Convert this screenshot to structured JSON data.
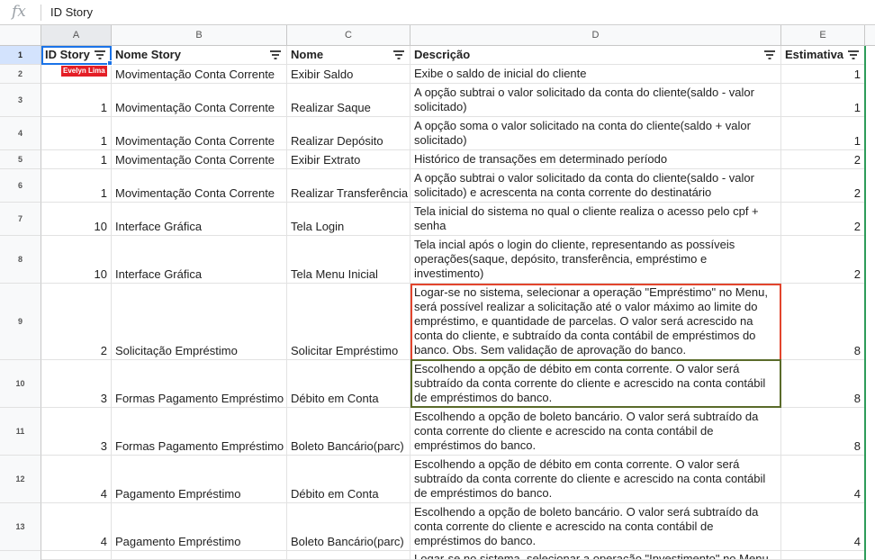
{
  "formula_bar": {
    "icon": "fx-icon",
    "value": "ID Story"
  },
  "columns": [
    {
      "letter": "A",
      "header": "ID Story"
    },
    {
      "letter": "B",
      "header": "Nome Story"
    },
    {
      "letter": "C",
      "header": "Nome"
    },
    {
      "letter": "D",
      "header": "Descrição"
    },
    {
      "letter": "E",
      "header": "Estimativa"
    }
  ],
  "active_cell": "A1",
  "collaborator_tag": "Evelyn Lima",
  "row_numbers": [
    "1",
    "2",
    "3",
    "4",
    "5",
    "6",
    "7",
    "8",
    "9",
    "10",
    "11",
    "12",
    "13"
  ],
  "rows": [
    {
      "id": "",
      "story": "Movimentação Conta Corrente",
      "nome": "Exibir Saldo",
      "descricao": "Exibe o saldo de inicial do cliente",
      "estimativa": "1"
    },
    {
      "id": "1",
      "story": "Movimentação Conta Corrente",
      "nome": "Realizar Saque",
      "descricao": "A opção subtrai o valor solicitado da conta do cliente(saldo - valor solicitado)",
      "estimativa": "1"
    },
    {
      "id": "1",
      "story": "Movimentação Conta Corrente",
      "nome": "Realizar Depósito",
      "descricao": "A opção soma o valor solicitado na conta do cliente(saldo + valor solicitado)",
      "estimativa": "1"
    },
    {
      "id": "1",
      "story": "Movimentação Conta Corrente",
      "nome": "Exibir Extrato",
      "descricao": "Histórico de transações em determinado período",
      "estimativa": "2"
    },
    {
      "id": "1",
      "story": "Movimentação Conta Corrente",
      "nome": "Realizar Transferência",
      "descricao": "A opção subtrai o valor solicitado da conta do cliente(saldo - valor solicitado) e acrescenta na conta corrente do destinatário",
      "estimativa": "2"
    },
    {
      "id": "10",
      "story": "Interface Gráfica",
      "nome": "Tela Login",
      "descricao": "Tela inicial do sistema no qual o cliente realiza o acesso pelo cpf + senha",
      "estimativa": "2"
    },
    {
      "id": "10",
      "story": "Interface Gráfica",
      "nome": "Tela Menu Inicial",
      "descricao": "Tela incial após o login do cliente, representando as possíveis operações(saque, depósito, transferência, empréstimo e investimento)",
      "estimativa": "2"
    },
    {
      "id": "2",
      "story": "Solicitação Empréstimo",
      "nome": "Solicitar Empréstimo",
      "descricao": "Logar-se no sistema, selecionar a operação \"Empréstimo\" no Menu, será possível realizar a solicitação até o valor máximo ao limite do empréstimo, e quantidade de parcelas. O valor será acrescido na conta do cliente, e subtraído da conta contábil de empréstimos do banco. Obs. Sem validação de aprovação do banco.",
      "estimativa": "8"
    },
    {
      "id": "3",
      "story": "Formas Pagamento Empréstimo",
      "nome": "Débito em Conta",
      "descricao": "Escolhendo a opção de débito em conta corrente. O valor será subtraído da conta corrente do cliente e acrescido na conta contábil de empréstimos do banco.",
      "estimativa": "8"
    },
    {
      "id": "3",
      "story": "Formas Pagamento Empréstimo",
      "nome": "Boleto Bancário(parc)",
      "descricao": "Escolhendo a opção de boleto bancário. O valor será subtraído da conta corrente do cliente e acrescido na conta contábil de empréstimos do banco.",
      "estimativa": "8"
    },
    {
      "id": "4",
      "story": "Pagamento Empréstimo",
      "nome": "Débito em Conta",
      "descricao": "Escolhendo a opção de débito em conta corrente. O valor será subtraído da conta corrente do cliente e acrescido na conta contábil de empréstimos do banco.",
      "estimativa": "4"
    },
    {
      "id": "4",
      "story": "Pagamento Empréstimo",
      "nome": "Boleto Bancário(parc)",
      "descricao": "Escolhendo a opção de boleto bancário. O valor será subtraído da conta corrente do cliente e acrescido na conta contábil de empréstimos do banco.",
      "estimativa": "4"
    },
    {
      "id": "",
      "story": "",
      "nome": "",
      "descricao": "Logar-se no sistema, selecionar a operação \"Investimento\" no Menu",
      "estimativa": ""
    }
  ],
  "colors": {
    "selection_blue": "#1a73e8",
    "collaborator_red": "#e41e26",
    "cursor_red_border": "#e2452d",
    "cursor_olive_border": "#5a6b2a",
    "green_edge": "#2e9c5a"
  }
}
